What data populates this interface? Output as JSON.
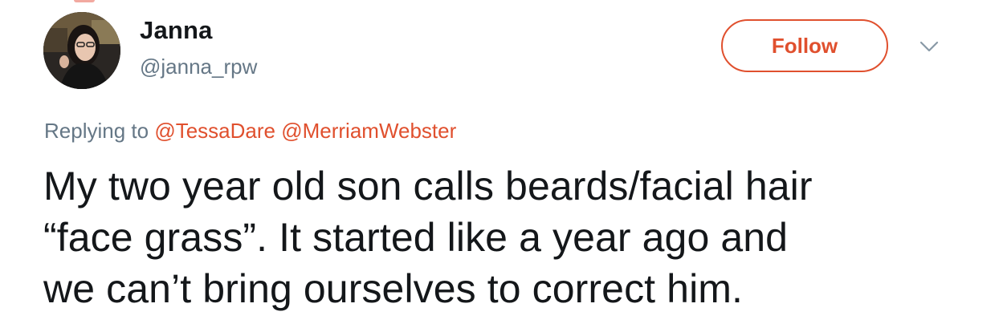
{
  "user": {
    "name": "Janna",
    "handle": "@janna_rpw"
  },
  "actions": {
    "follow_label": "Follow"
  },
  "reply": {
    "prefix": "Replying to",
    "mentions": [
      "@TessaDare",
      "@MerriamWebster"
    ]
  },
  "tweet": {
    "lines": [
      "My two year old son calls beards/facial hair",
      "“face grass”. It started like a year ago and",
      "we can’t bring ourselves to correct him."
    ]
  },
  "colors": {
    "accent": "#e0502e",
    "text": "#14171a",
    "secondary": "#657786"
  },
  "icons": {
    "menu": "chevron-down-icon",
    "avatar": "avatar"
  }
}
